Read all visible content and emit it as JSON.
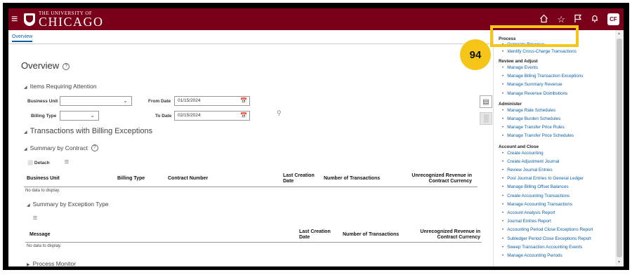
{
  "header": {
    "logo_small": "THE UNIVERSITY OF",
    "logo_big": "CHICAGO",
    "avatar_initials": "CF",
    "brand_color": "#7a0019",
    "icons": [
      "menu-icon",
      "home-icon",
      "star-icon",
      "flag-icon",
      "bell-icon"
    ]
  },
  "tabs": [
    {
      "label": "Overview"
    }
  ],
  "main": {
    "title": "Overview",
    "items_requiring_attention": "Items Requiring Attention",
    "filters": {
      "business_unit_label": "Business Unit",
      "business_unit_value": "",
      "billing_type_label": "Billing Type",
      "billing_type_value": "",
      "from_date_label": "From Date",
      "from_date_value": "01/15/2024",
      "to_date_label": "To Date",
      "to_date_value": "02/15/2024"
    },
    "transactions_section": "Transactions with Billing Exceptions",
    "summary_contract": {
      "title": "Summary by Contract",
      "detach_label": "Detach",
      "columns": [
        "Business Unit",
        "Billing Type",
        "Contract Number",
        "Last Creation Date",
        "Number of Transactions",
        "Unrecognized Revenue in Contract Currency"
      ],
      "no_data": "No data to display."
    },
    "summary_exception": {
      "title": "Summary by Exception Type",
      "columns": [
        "Message",
        "Last Creation Date",
        "Number of Transactions",
        "Unrecognized Revenue in Contract Currency"
      ],
      "no_data": "No data to display."
    },
    "process_monitor": "Process Monitor"
  },
  "tasks": {
    "groups": [
      {
        "name": "Process",
        "items": [
          "Generate Revenue",
          "Identify Cross-Charge Transactions"
        ]
      },
      {
        "name": "Review and Adjust",
        "items": [
          "Manage Events",
          "Manage Billing Transaction Exceptions",
          "Manage Summary Revenue",
          "Manage Revenue Distributions"
        ]
      },
      {
        "name": "Administer",
        "items": [
          "Manage Rate Schedules",
          "Manage Burden Schedules",
          "Manage Transfer Price Rules",
          "Manage Transfer Price Schedules"
        ]
      },
      {
        "name": "Account and Close",
        "items": [
          "Create Accounting",
          "Create Adjustment Journal",
          "Review Journal Entries",
          "Post Journal Entries to General Ledger",
          "Manage Billing Offset Balances",
          "Create Accounting Transactions",
          "Manage Accounting Transactions",
          "Account Analysis Report",
          "Journal Entries Report",
          "Accounting Period Close Exceptions Report",
          "Subledger Period Close Exceptions Report",
          "Sweep Transaction Accounting Events",
          "Manage Accounting Periods"
        ]
      }
    ]
  },
  "annotation": {
    "step_number": "94",
    "highlight_color": "#f5c518"
  }
}
